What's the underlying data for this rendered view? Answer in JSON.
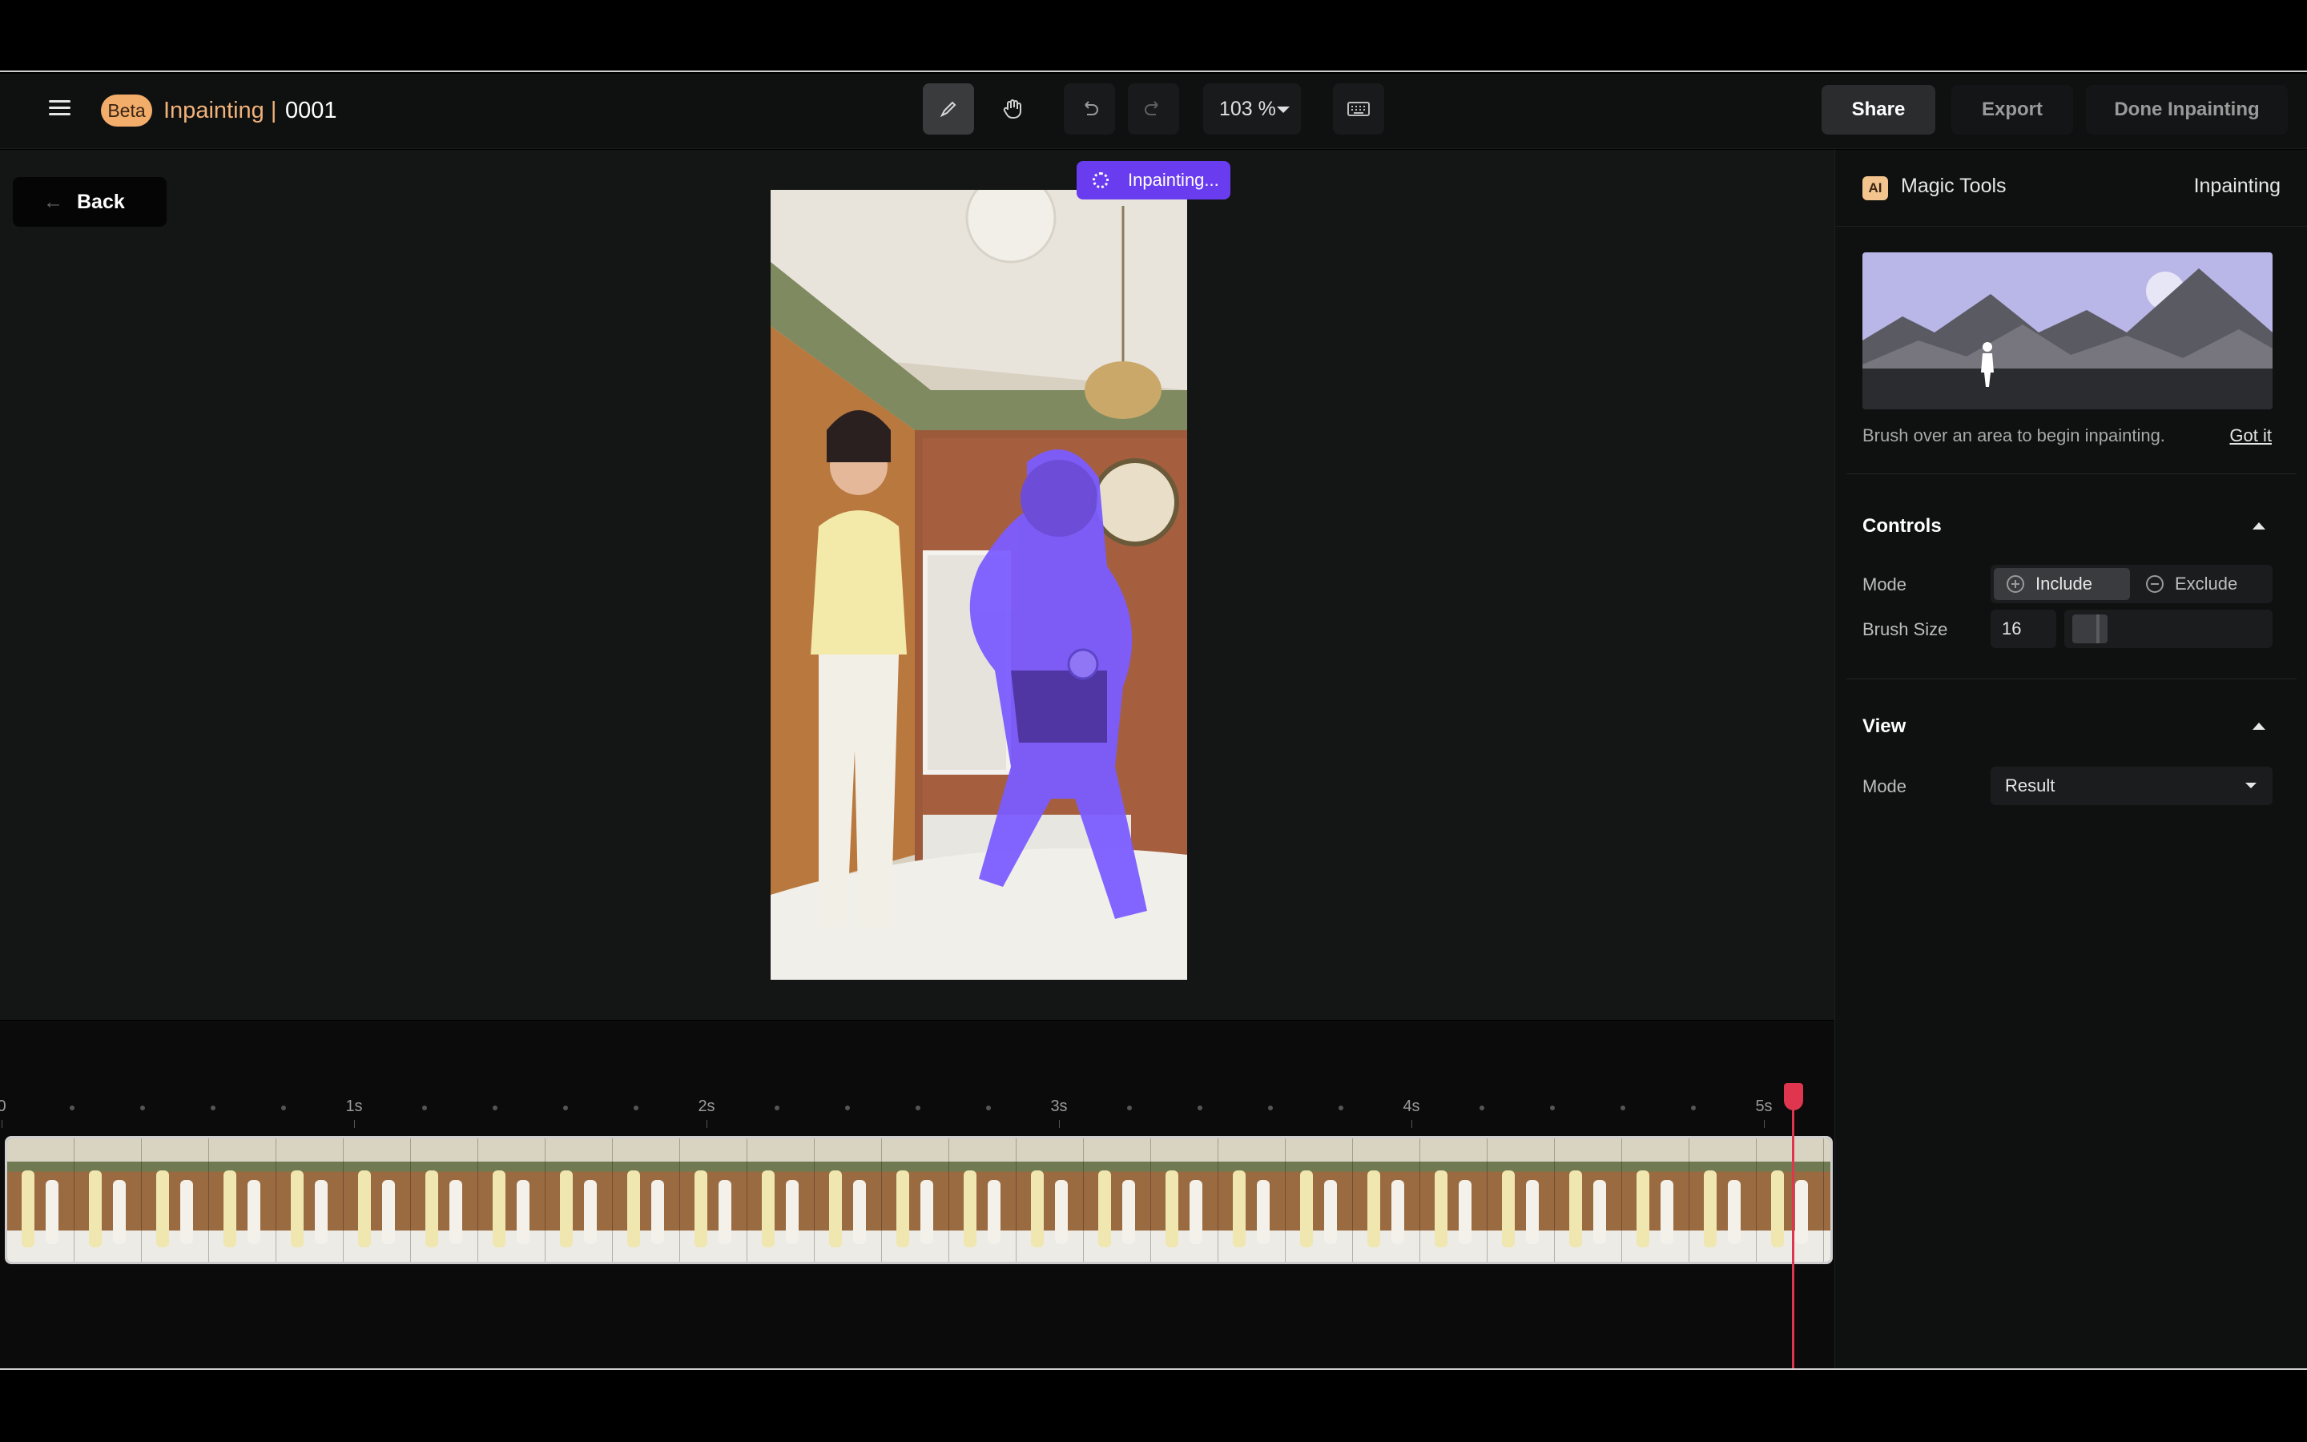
{
  "header": {
    "badge": "Beta",
    "app_title": "Inpainting |",
    "project_id": "0001",
    "zoom": "103 %",
    "share_label": "Share",
    "export_label": "Export",
    "done_label": "Done Inpainting",
    "tools": [
      "brush-icon",
      "hand-icon",
      "undo-icon",
      "redo-icon",
      "keyboard-icon"
    ]
  },
  "canvas": {
    "back_label": "Back",
    "status": "Inpainting..."
  },
  "timeline": {
    "ticks": [
      "0",
      "1s",
      "2s",
      "3s",
      "4s",
      "5s"
    ],
    "playhead_time": 5.1,
    "duration_visible": 5.2
  },
  "panel": {
    "ai_badge": "AI",
    "title": "Magic Tools",
    "mode_title": "Inpainting",
    "hint": "Brush over an area to begin inpainting.",
    "gotit": "Got it",
    "controls_title": "Controls",
    "mode_label": "Mode",
    "include_label": "Include",
    "exclude_label": "Exclude",
    "brush_label": "Brush Size",
    "brush_value": "16",
    "view_title": "View",
    "view_mode_label": "Mode",
    "view_mode_value": "Result"
  },
  "colors": {
    "accent": "#6a3cf0",
    "beta": "#f2ad6b",
    "playhead": "#e0354f",
    "mask": "#7b5cff"
  }
}
